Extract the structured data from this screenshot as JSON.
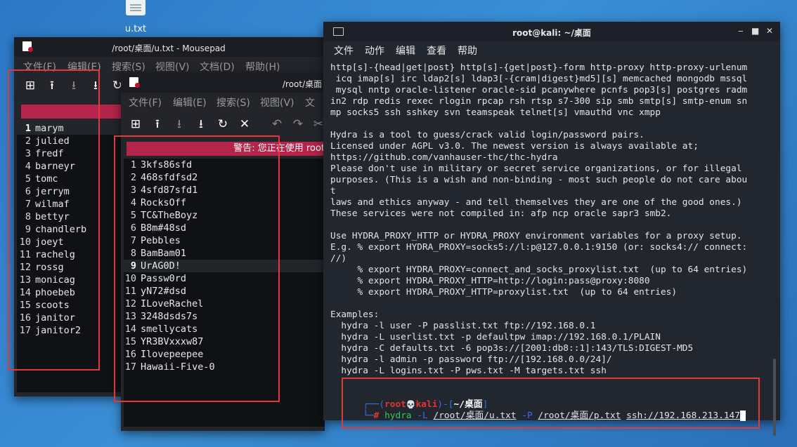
{
  "desktop": {
    "file_icon_label": "u.txt"
  },
  "mousepad_back": {
    "title": "/root/桌面/u.txt - Mousepad",
    "menu": [
      "文件(F)",
      "编辑(E)",
      "搜索(S)",
      "视图(V)",
      "文档(D)",
      "帮助(H)"
    ],
    "lines": [
      "marym",
      "julied",
      "fredf",
      "barneyr",
      "tomc",
      "jerrym",
      "wilmaf",
      "bettyr",
      "chandlerb",
      "joeyt",
      "rachelg",
      "rossg",
      "monicag",
      "phoebeb",
      "scoots",
      "janitor",
      "janitor2"
    ],
    "current_line": 1
  },
  "mousepad_front": {
    "title": "/root/桌面/p.txt - Mousepad",
    "title_visible": "/root/桌面",
    "menu": [
      "文件(F)",
      "编辑(E)",
      "搜索(S)",
      "视图(V)",
      "文"
    ],
    "warning": "警告: 您正在使用 root",
    "lines": [
      "3kfs86sfd",
      "468sfdfsd2",
      "4sfd87sfd1",
      "RocksOff",
      "TC&TheBoyz",
      "B8m#48sd",
      "Pebbles",
      "BamBam01",
      "UrAG0D!",
      "Passw0rd",
      "yN72#dsd",
      "ILoveRachel",
      "3248dsds7s",
      "smellycats",
      "YR3BVxxxw87",
      "Ilovepeepee",
      "Hawaii-Five-0"
    ],
    "current_line": 9
  },
  "terminal": {
    "title": "root@kali: ~/桌面",
    "menu": [
      "文件",
      "动作",
      "编辑",
      "查看",
      "帮助"
    ],
    "output": [
      "http[s]-{head|get|post} http[s]-{get|post}-form http-proxy http-proxy-urlenum",
      " icq imap[s] irc ldap2[s] ldap3[-{cram|digest}md5][s] memcached mongodb mssql",
      " mysql nntp oracle-listener oracle-sid pcanywhere pcnfs pop3[s] postgres radm",
      "in2 rdp redis rexec rlogin rpcap rsh rtsp s7-300 sip smb smtp[s] smtp-enum sn",
      "mp socks5 ssh sshkey svn teamspeak telnet[s] vmauthd vnc xmpp",
      "",
      "Hydra is a tool to guess/crack valid login/password pairs.",
      "Licensed under AGPL v3.0. The newest version is always available at;",
      "https://github.com/vanhauser-thc/thc-hydra",
      "Please don't use in military or secret service organizations, or for illegal",
      "purposes. (This is a wish and non-binding - most such people do not care abou",
      "t",
      "laws and ethics anyway - and tell themselves they are one of the good ones.)",
      "These services were not compiled in: afp ncp oracle sapr3 smb2.",
      "",
      "Use HYDRA_PROXY_HTTP or HYDRA_PROXY environment variables for a proxy setup.",
      "E.g. % export HYDRA_PROXY=socks5://l:p@127.0.0.1:9150 (or: socks4:// connect:",
      "//)",
      "     % export HYDRA_PROXY=connect_and_socks_proxylist.txt  (up to 64 entries)",
      "     % export HYDRA_PROXY_HTTP=http://login:pass@proxy:8080",
      "     % export HYDRA_PROXY_HTTP=proxylist.txt  (up to 64 entries)",
      "",
      "Examples:",
      "  hydra -l user -P passlist.txt ftp://192.168.0.1",
      "  hydra -L userlist.txt -p defaultpw imap://192.168.0.1/PLAIN",
      "  hydra -C defaults.txt -6 pop3s://[2001:db8::1]:143/TLS:DIGEST-MD5",
      "  hydra -l admin -p password ftp://[192.168.0.0/24]/",
      "  hydra -L logins.txt -P pws.txt -M targets.txt ssh"
    ],
    "prompt": {
      "user": "root",
      "skull": "💀",
      "host": "kali",
      "cwd": "~/桌面",
      "hash": "#",
      "cmd": "hydra",
      "flag_L": "-L",
      "user_file": "/root/桌面/u.txt",
      "flag_P": "-P",
      "pass_file": "/root/桌面/p.txt",
      "target": "ssh://192.168.213.147"
    }
  },
  "colors": {
    "prompt_blue": "#3b6fe0",
    "prompt_red": "#e5342f",
    "cmd_green": "#34c759",
    "warn_bg": "#b5244a",
    "annotation_red": "#e03a3a"
  }
}
